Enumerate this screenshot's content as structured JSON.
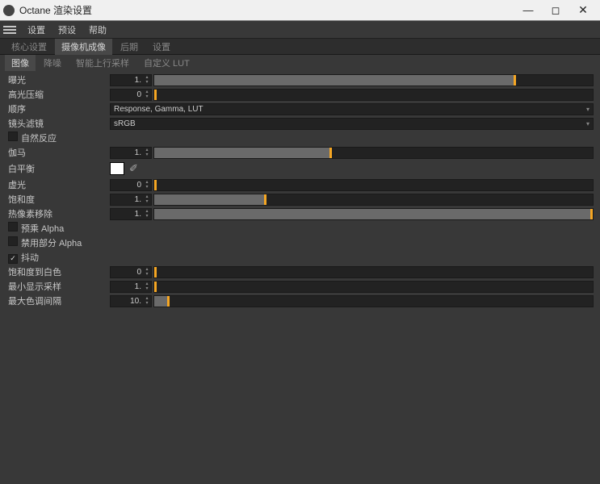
{
  "window": {
    "title": "Octane 渲染设置"
  },
  "menu": {
    "settings": "设置",
    "preset": "预设",
    "help": "帮助"
  },
  "tabs": {
    "core": "核心设置",
    "camera": "摄像机成像",
    "post": "后期",
    "cfg": "设置"
  },
  "subtabs": {
    "image": "图像",
    "denoise": "降噪",
    "upsample": "智能上行采样",
    "lut": "自定义 LUT"
  },
  "labels": {
    "exposure": "曝光",
    "highlight": "高光压缩",
    "order": "顺序",
    "lensfilter": "镜头滤镜",
    "natural": "自然反应",
    "gamma": "伽马",
    "wb": "白平衡",
    "vignette": "虚光",
    "saturation": "饱和度",
    "hotpixel": "热像素移除",
    "prealpha": "预乘 Alpha",
    "partalpha": "禁用部分 Alpha",
    "dither": "抖动",
    "sat2white": "饱和度到白色",
    "minsamples": "最小显示采样",
    "maxtone": "最大色调间隔"
  },
  "values": {
    "exposure": "1.",
    "highlight": "0",
    "gamma": "1.",
    "vignette": "0",
    "saturation": "1.",
    "hotpixel": "1.",
    "sat2white": "0",
    "minsamples": "1.",
    "maxtone": "10."
  },
  "selects": {
    "order": "Response, Gamma, LUT",
    "lensfilter": "sRGB"
  },
  "checks": {
    "natural": false,
    "prealpha": false,
    "partalpha": false,
    "dither": true
  },
  "colors": {
    "accent": "#f5a623",
    "wb": "#ffffff"
  },
  "sliders": {
    "exposure": 82,
    "highlight": 0,
    "gamma": 40,
    "vignette": 0,
    "saturation": 25,
    "hotpixel": 100,
    "sat2white": 0,
    "minsamples": 0,
    "maxtone": 3
  }
}
